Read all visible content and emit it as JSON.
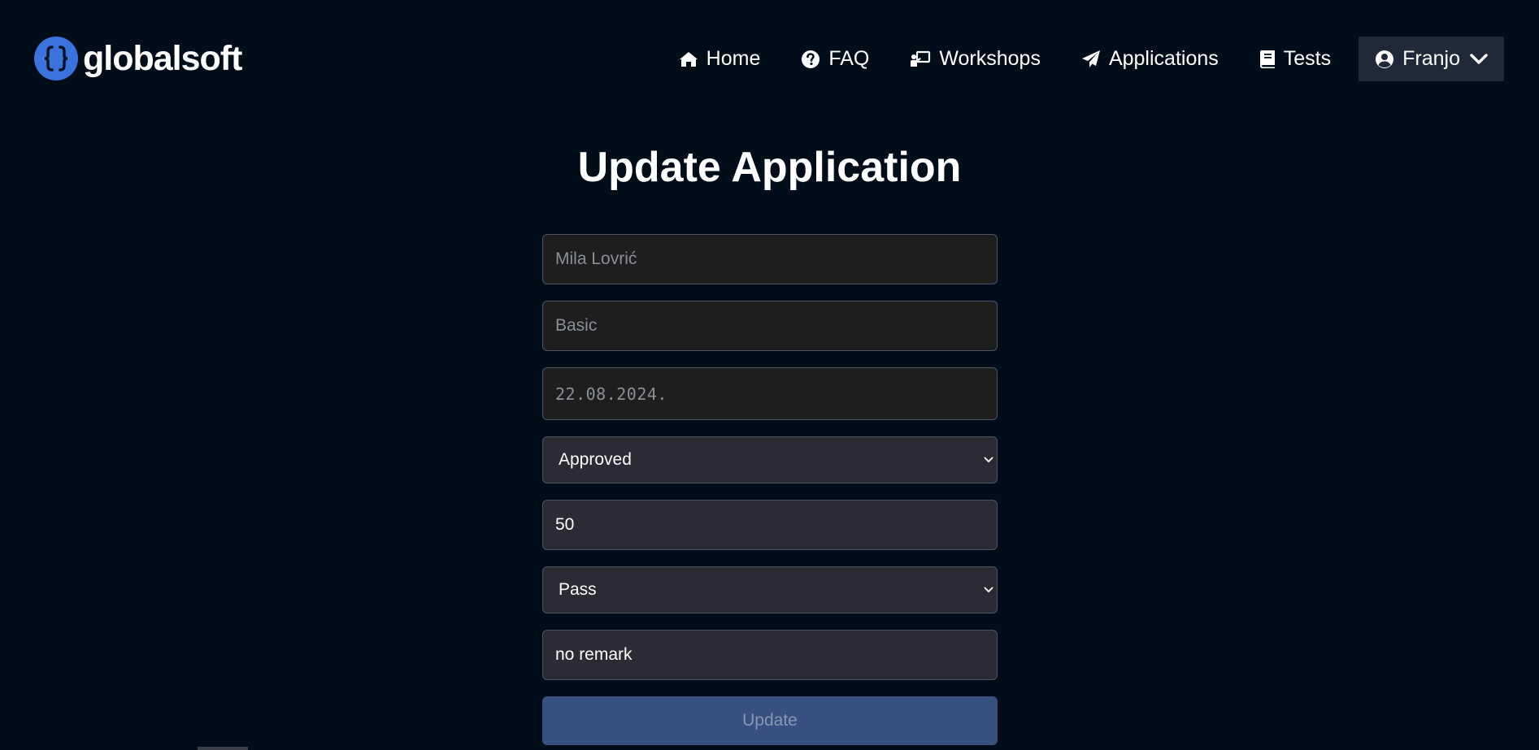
{
  "brand": {
    "name": "globalsoft",
    "logo_icon": "curly-braces-icon",
    "logo_color": "#3b73de"
  },
  "nav": {
    "items": [
      {
        "label": "Home",
        "icon": "home-icon"
      },
      {
        "label": "FAQ",
        "icon": "question-circle-icon"
      },
      {
        "label": "Workshops",
        "icon": "chalkboard-teacher-icon"
      },
      {
        "label": "Applications",
        "icon": "paper-plane-icon"
      },
      {
        "label": "Tests",
        "icon": "book-icon"
      }
    ],
    "user": {
      "name": "Franjo",
      "icon": "user-circle-icon",
      "menu_icon": "chevron-down-icon"
    }
  },
  "page": {
    "title": "Update Application"
  },
  "form": {
    "applicant_name": "Mila Lovrić",
    "workshop": "Basic",
    "date": "22.08.2024.",
    "status": "Approved",
    "points": "50",
    "result": "Pass",
    "remark": "no remark",
    "submit_label": "Update"
  },
  "colors": {
    "background": "#020d1a",
    "disabled_field": "#1e1e1e",
    "active_field": "#2b2b33",
    "submit_button": "#37507f",
    "user_menu_bg": "#1f2937"
  }
}
